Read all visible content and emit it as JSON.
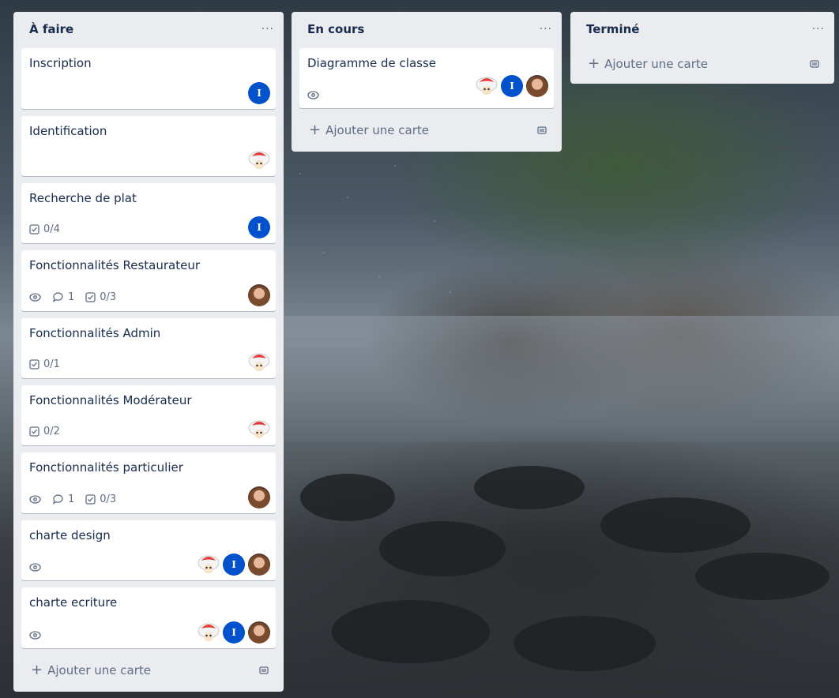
{
  "lists": [
    {
      "title": "À faire",
      "menu": "···",
      "cards": [
        {
          "title": "Inscription",
          "badges": {},
          "members": [
            "i"
          ]
        },
        {
          "title": "Identification",
          "badges": {},
          "members": [
            "mushroom"
          ]
        },
        {
          "title": "Recherche de plat",
          "badges": {
            "checklist": "0/4"
          },
          "members": [
            "i"
          ]
        },
        {
          "title": "Fonctionnalités Restaurateur",
          "badges": {
            "watch": true,
            "comments": "1",
            "checklist": "0/3"
          },
          "members": [
            "photo"
          ]
        },
        {
          "title": "Fonctionnalités Admin",
          "badges": {
            "checklist": "0/1"
          },
          "members": [
            "mushroom"
          ]
        },
        {
          "title": "Fonctionnalités Modérateur",
          "badges": {
            "checklist": "0/2"
          },
          "members": [
            "mushroom"
          ]
        },
        {
          "title": "Fonctionnalités particulier",
          "badges": {
            "watch": true,
            "comments": "1",
            "checklist": "0/3"
          },
          "members": [
            "photo"
          ]
        },
        {
          "title": "charte design",
          "badges": {
            "watch": true
          },
          "members": [
            "mushroom",
            "i",
            "photo"
          ]
        },
        {
          "title": "charte ecriture",
          "badges": {
            "watch": true
          },
          "members": [
            "mushroom",
            "i",
            "photo"
          ]
        }
      ],
      "add_card": "Ajouter une carte"
    },
    {
      "title": "En cours",
      "menu": "···",
      "cards": [
        {
          "title": "Diagramme de classe",
          "badges": {
            "watch": true
          },
          "members": [
            "mushroom",
            "i",
            "photo"
          ]
        }
      ],
      "add_card": "Ajouter une carte"
    },
    {
      "title": "Terminé",
      "menu": "···",
      "cards": [],
      "add_card": "Ajouter une carte"
    }
  ],
  "avatar_initial": "I",
  "icons": {
    "watch": "eye-icon",
    "comments": "comment-icon",
    "checklist": "checklist-icon",
    "template": "card-template-icon",
    "plus": "plus-icon"
  },
  "colors": {
    "list_bg": "#ebecf0",
    "card_bg": "#ffffff",
    "avatar_blue": "#0052cc",
    "text": "#172b4d",
    "subtle": "#5e6c84"
  }
}
